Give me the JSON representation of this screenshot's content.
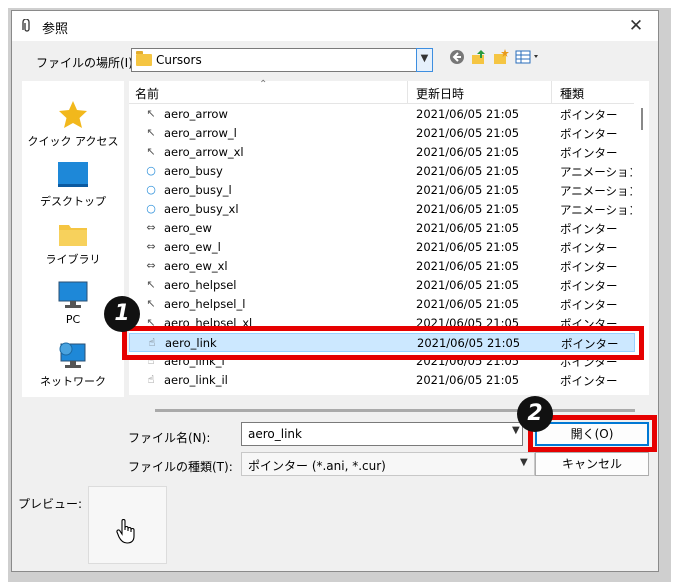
{
  "window": {
    "title": "参照",
    "close_glyph": "✕"
  },
  "location": {
    "label": "ファイルの場所(I):",
    "value": "Cursors"
  },
  "toolbar": {
    "icons": [
      "back-icon",
      "up-folder-icon",
      "new-folder-icon",
      "view-menu-icon"
    ]
  },
  "sidebar": {
    "items": [
      {
        "label": "クイック アクセス",
        "icon": "star-icon"
      },
      {
        "label": "デスクトップ",
        "icon": "desktop-icon"
      },
      {
        "label": "ライブラリ",
        "icon": "library-icon"
      },
      {
        "label": "PC",
        "icon": "pc-icon"
      },
      {
        "label": "ネットワーク",
        "icon": "network-icon"
      }
    ]
  },
  "list": {
    "columns": [
      "名前",
      "更新日時",
      "種類"
    ],
    "rows": [
      {
        "name": "aero_arrow",
        "date": "2021/06/05 21:05",
        "type": "ポインター",
        "icon": "↖"
      },
      {
        "name": "aero_arrow_l",
        "date": "2021/06/05 21:05",
        "type": "ポインター",
        "icon": "↖"
      },
      {
        "name": "aero_arrow_xl",
        "date": "2021/06/05 21:05",
        "type": "ポインター",
        "icon": "↖"
      },
      {
        "name": "aero_busy",
        "date": "2021/06/05 21:05",
        "type": "アニメーション ポインター",
        "icon": "○"
      },
      {
        "name": "aero_busy_l",
        "date": "2021/06/05 21:05",
        "type": "アニメーション ポインター",
        "icon": "○"
      },
      {
        "name": "aero_busy_xl",
        "date": "2021/06/05 21:05",
        "type": "アニメーション ポインター",
        "icon": "○"
      },
      {
        "name": "aero_ew",
        "date": "2021/06/05 21:05",
        "type": "ポインター",
        "icon": "⇔"
      },
      {
        "name": "aero_ew_l",
        "date": "2021/06/05 21:05",
        "type": "ポインター",
        "icon": "⇔"
      },
      {
        "name": "aero_ew_xl",
        "date": "2021/06/05 21:05",
        "type": "ポインター",
        "icon": "⇔"
      },
      {
        "name": "aero_helpsel",
        "date": "2021/06/05 21:05",
        "type": "ポインター",
        "icon": "↖"
      },
      {
        "name": "aero_helpsel_l",
        "date": "2021/06/05 21:05",
        "type": "ポインター",
        "icon": "↖"
      },
      {
        "name": "aero_helpsel_xl",
        "date": "2021/06/05 21:05",
        "type": "ポインター",
        "icon": "↖"
      },
      {
        "name": "aero_link",
        "date": "2021/06/05 21:05",
        "type": "ポインター",
        "icon": "☝",
        "selected": true
      },
      {
        "name": "aero_link_l",
        "date": "2021/06/05 21:05",
        "type": "ポインター",
        "icon": "☝"
      },
      {
        "name": "aero_link_il",
        "date": "2021/06/05 21:05",
        "type": "ポインター",
        "icon": "☝"
      }
    ]
  },
  "filename": {
    "label": "ファイル名(N):",
    "value": "aero_link"
  },
  "filetype": {
    "label": "ファイルの種類(T):",
    "value": "ポインター (*.ani, *.cur)"
  },
  "buttons": {
    "open": "開く(O)",
    "cancel": "キャンセル"
  },
  "preview": {
    "label": "プレビュー:"
  },
  "annotations": {
    "badge1": "1",
    "badge2": "2",
    "highlight_color": "#e60000"
  }
}
